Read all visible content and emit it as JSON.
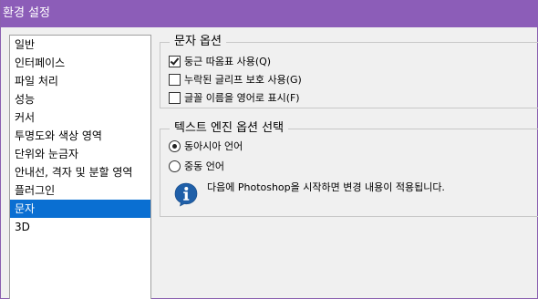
{
  "window": {
    "title": "환경 설정"
  },
  "sidebar": {
    "selected_index": 9,
    "items": [
      {
        "label": "일반"
      },
      {
        "label": "인터페이스"
      },
      {
        "label": "파일 처리"
      },
      {
        "label": "성능"
      },
      {
        "label": "커서"
      },
      {
        "label": "투명도와 색상 영역"
      },
      {
        "label": "단위와 눈금자"
      },
      {
        "label": "안내선, 격자 및 분할 영역"
      },
      {
        "label": "플러그인"
      },
      {
        "label": "문자"
      },
      {
        "label": "3D"
      }
    ]
  },
  "text_options": {
    "legend": "문자 옵션",
    "options": [
      {
        "label": "둥근 따옴표 사용(Q)",
        "checked": true
      },
      {
        "label": "누락된 글리프 보호 사용(G)",
        "checked": false
      },
      {
        "label": "글꼴 이름을 영어로 표시(F)",
        "checked": false
      }
    ]
  },
  "engine_options": {
    "legend": "텍스트 엔진 옵션 선택",
    "radios": [
      {
        "label": "동아시아 언어",
        "selected": true
      },
      {
        "label": "중동 언어",
        "selected": false
      }
    ],
    "info_icon": "info-icon",
    "info_text": "다음에 Photoshop을 시작하면 변경 내용이 적용됩니다."
  },
  "colors": {
    "titlebar": "#8c5db8",
    "selection": "#0a6fd2",
    "info_icon": "#1f5fa8"
  }
}
